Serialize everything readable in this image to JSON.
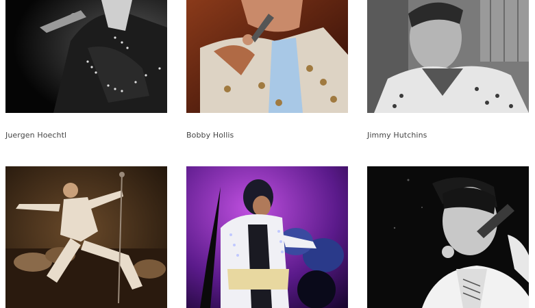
{
  "gallery": {
    "items": [
      {
        "name": "Juergen Hoechtl"
      },
      {
        "name": "Bobby Hollis"
      },
      {
        "name": "Jimmy Hutchins"
      },
      {
        "name": ""
      },
      {
        "name": ""
      },
      {
        "name": ""
      }
    ]
  },
  "colors": {
    "background": "#ffffff",
    "caption_text": "#444444"
  }
}
